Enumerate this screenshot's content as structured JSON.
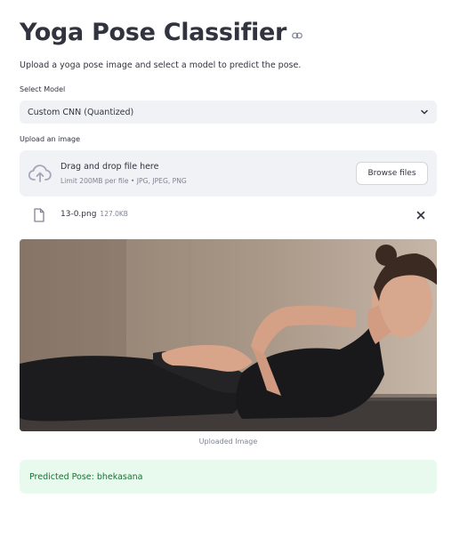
{
  "page": {
    "title": "Yoga Pose Classifier",
    "subtitle": "Upload a yoga pose image and select a model to predict the pose."
  },
  "model_select": {
    "label": "Select Model",
    "value": "Custom CNN (Quantized)",
    "icon": "chevron-down-icon"
  },
  "uploader": {
    "label": "Upload an image",
    "dropzone_title": "Drag and drop file here",
    "dropzone_hint": "Limit 200MB per file • JPG, JPEG, PNG",
    "browse_label": "Browse files",
    "icon": "cloud-upload-icon"
  },
  "uploaded_file": {
    "name": "13-0.png",
    "size": "127.0KB"
  },
  "image": {
    "caption": "Uploaded Image"
  },
  "result": {
    "text": "Predicted Pose: bhekasana"
  },
  "colors": {
    "text": "#31333f",
    "muted": "#808495",
    "input_bg": "#f0f2f6",
    "success_bg": "#e8f9ee",
    "success_text": "#177233"
  }
}
